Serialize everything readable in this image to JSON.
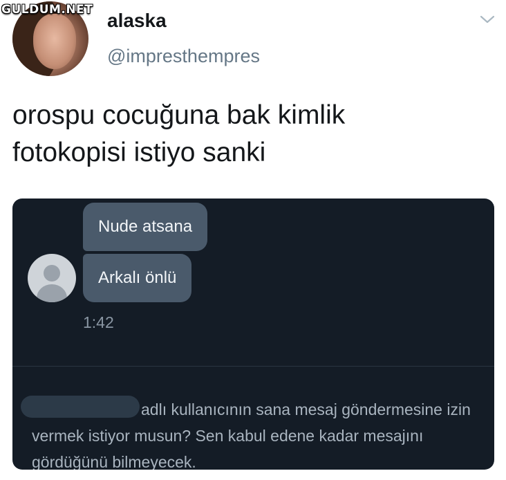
{
  "watermark": "GULDUM.NET",
  "tweet": {
    "display_name": "alaska",
    "handle": "@impresthempres",
    "text": "orospu cocuğuna bak kimlik\nfotokopisi istiyo sanki"
  },
  "embedded_screenshot": {
    "messages": [
      {
        "text": "Nude atsana"
      },
      {
        "text": "Arkalı önlü"
      }
    ],
    "timestamp": "1:42",
    "request_notice": "adlı kullanıcının sana mesaj göndermesine izin vermek istiyor musun? Sen kabul edene kadar mesajını gördüğünü bilmeyecek."
  },
  "colors": {
    "chat_background": "#141c26",
    "bubble": "#4a5a6b",
    "handle_gray": "#657786"
  }
}
